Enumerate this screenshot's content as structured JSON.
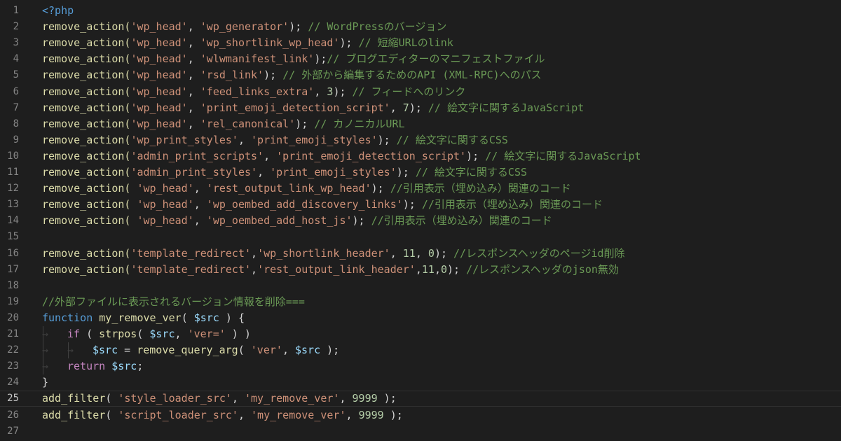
{
  "editor": {
    "language": "php",
    "active_line": 25,
    "lines": [
      {
        "n": "1",
        "tokens": [
          {
            "t": "<?php",
            "c": "tag"
          }
        ]
      },
      {
        "n": "2",
        "tokens": [
          {
            "t": "remove_action(",
            "c": "fn"
          },
          {
            "t": "'wp_head'",
            "c": "str"
          },
          {
            "t": ", ",
            "c": "pun"
          },
          {
            "t": "'wp_generator'",
            "c": "str"
          },
          {
            "t": "); ",
            "c": "pun"
          },
          {
            "t": "// WordPressのバージョン",
            "c": "cmt"
          }
        ]
      },
      {
        "n": "3",
        "tokens": [
          {
            "t": "remove_action(",
            "c": "fn"
          },
          {
            "t": "'wp_head'",
            "c": "str"
          },
          {
            "t": ", ",
            "c": "pun"
          },
          {
            "t": "'wp_shortlink_wp_head'",
            "c": "str"
          },
          {
            "t": "); ",
            "c": "pun"
          },
          {
            "t": "// 短縮URLのlink",
            "c": "cmt"
          }
        ]
      },
      {
        "n": "4",
        "tokens": [
          {
            "t": "remove_action(",
            "c": "fn"
          },
          {
            "t": "'wp_head'",
            "c": "str"
          },
          {
            "t": ", ",
            "c": "pun"
          },
          {
            "t": "'wlwmanifest_link'",
            "c": "str"
          },
          {
            "t": ");",
            "c": "pun"
          },
          {
            "t": "// ブログエディターのマニフェストファイル",
            "c": "cmt"
          }
        ]
      },
      {
        "n": "5",
        "tokens": [
          {
            "t": "remove_action(",
            "c": "fn"
          },
          {
            "t": "'wp_head'",
            "c": "str"
          },
          {
            "t": ", ",
            "c": "pun"
          },
          {
            "t": "'rsd_link'",
            "c": "str"
          },
          {
            "t": "); ",
            "c": "pun"
          },
          {
            "t": "// 外部から編集するためのAPI (XML-RPC)へのパス",
            "c": "cmt"
          }
        ]
      },
      {
        "n": "6",
        "tokens": [
          {
            "t": "remove_action(",
            "c": "fn"
          },
          {
            "t": "'wp_head'",
            "c": "str"
          },
          {
            "t": ", ",
            "c": "pun"
          },
          {
            "t": "'feed_links_extra'",
            "c": "str"
          },
          {
            "t": ", ",
            "c": "pun"
          },
          {
            "t": "3",
            "c": "num"
          },
          {
            "t": "); ",
            "c": "pun"
          },
          {
            "t": "// フィードへのリンク",
            "c": "cmt"
          }
        ]
      },
      {
        "n": "7",
        "tokens": [
          {
            "t": "remove_action(",
            "c": "fn"
          },
          {
            "t": "'wp_head'",
            "c": "str"
          },
          {
            "t": ", ",
            "c": "pun"
          },
          {
            "t": "'print_emoji_detection_script'",
            "c": "str"
          },
          {
            "t": ", ",
            "c": "pun"
          },
          {
            "t": "7",
            "c": "num"
          },
          {
            "t": "); ",
            "c": "pun"
          },
          {
            "t": "// 絵文字に関するJavaScript",
            "c": "cmt"
          }
        ]
      },
      {
        "n": "8",
        "tokens": [
          {
            "t": "remove_action(",
            "c": "fn"
          },
          {
            "t": "'wp_head'",
            "c": "str"
          },
          {
            "t": ", ",
            "c": "pun"
          },
          {
            "t": "'rel_canonical'",
            "c": "str"
          },
          {
            "t": "); ",
            "c": "pun"
          },
          {
            "t": "// カノニカルURL",
            "c": "cmt"
          }
        ]
      },
      {
        "n": "9",
        "tokens": [
          {
            "t": "remove_action(",
            "c": "fn"
          },
          {
            "t": "'wp_print_styles'",
            "c": "str"
          },
          {
            "t": ", ",
            "c": "pun"
          },
          {
            "t": "'print_emoji_styles'",
            "c": "str"
          },
          {
            "t": "); ",
            "c": "pun"
          },
          {
            "t": "// 絵文字に関するCSS",
            "c": "cmt"
          }
        ]
      },
      {
        "n": "10",
        "tokens": [
          {
            "t": "remove_action(",
            "c": "fn"
          },
          {
            "t": "'admin_print_scripts'",
            "c": "str"
          },
          {
            "t": ", ",
            "c": "pun"
          },
          {
            "t": "'print_emoji_detection_script'",
            "c": "str"
          },
          {
            "t": "); ",
            "c": "pun"
          },
          {
            "t": "// 絵文字に関するJavaScript",
            "c": "cmt"
          }
        ]
      },
      {
        "n": "11",
        "tokens": [
          {
            "t": "remove_action(",
            "c": "fn"
          },
          {
            "t": "'admin_print_styles'",
            "c": "str"
          },
          {
            "t": ", ",
            "c": "pun"
          },
          {
            "t": "'print_emoji_styles'",
            "c": "str"
          },
          {
            "t": "); ",
            "c": "pun"
          },
          {
            "t": "// 絵文字に関するCSS",
            "c": "cmt"
          }
        ]
      },
      {
        "n": "12",
        "tokens": [
          {
            "t": "remove_action( ",
            "c": "fn"
          },
          {
            "t": "'wp_head'",
            "c": "str"
          },
          {
            "t": ", ",
            "c": "pun"
          },
          {
            "t": "'rest_output_link_wp_head'",
            "c": "str"
          },
          {
            "t": "); ",
            "c": "pun"
          },
          {
            "t": "//引用表示（埋め込み）関連のコード",
            "c": "cmt"
          }
        ]
      },
      {
        "n": "13",
        "tokens": [
          {
            "t": "remove_action( ",
            "c": "fn"
          },
          {
            "t": "'wp_head'",
            "c": "str"
          },
          {
            "t": ", ",
            "c": "pun"
          },
          {
            "t": "'wp_oembed_add_discovery_links'",
            "c": "str"
          },
          {
            "t": "); ",
            "c": "pun"
          },
          {
            "t": "//引用表示（埋め込み）関連のコード",
            "c": "cmt"
          }
        ]
      },
      {
        "n": "14",
        "tokens": [
          {
            "t": "remove_action( ",
            "c": "fn"
          },
          {
            "t": "'wp_head'",
            "c": "str"
          },
          {
            "t": ", ",
            "c": "pun"
          },
          {
            "t": "'wp_oembed_add_host_js'",
            "c": "str"
          },
          {
            "t": "); ",
            "c": "pun"
          },
          {
            "t": "//引用表示（埋め込み）関連のコード",
            "c": "cmt"
          }
        ]
      },
      {
        "n": "15",
        "tokens": []
      },
      {
        "n": "16",
        "tokens": [
          {
            "t": "remove_action(",
            "c": "fn"
          },
          {
            "t": "'template_redirect'",
            "c": "str"
          },
          {
            "t": ",",
            "c": "pun"
          },
          {
            "t": "'wp_shortlink_header'",
            "c": "str"
          },
          {
            "t": ", ",
            "c": "pun"
          },
          {
            "t": "11",
            "c": "num"
          },
          {
            "t": ", ",
            "c": "pun"
          },
          {
            "t": "0",
            "c": "num"
          },
          {
            "t": "); ",
            "c": "pun"
          },
          {
            "t": "//レスポンスヘッダのページid削除",
            "c": "cmt"
          }
        ]
      },
      {
        "n": "17",
        "tokens": [
          {
            "t": "remove_action(",
            "c": "fn"
          },
          {
            "t": "'template_redirect'",
            "c": "str"
          },
          {
            "t": ",",
            "c": "pun"
          },
          {
            "t": "'rest_output_link_header'",
            "c": "str"
          },
          {
            "t": ",",
            "c": "pun"
          },
          {
            "t": "11",
            "c": "num"
          },
          {
            "t": ",",
            "c": "pun"
          },
          {
            "t": "0",
            "c": "num"
          },
          {
            "t": "); ",
            "c": "pun"
          },
          {
            "t": "//レスポンスヘッダのjson無効",
            "c": "cmt"
          }
        ]
      },
      {
        "n": "18",
        "tokens": []
      },
      {
        "n": "19",
        "tokens": [
          {
            "t": "//外部ファイルに表示されるバージョン情報を削除===",
            "c": "cmt"
          }
        ]
      },
      {
        "n": "20",
        "tokens": [
          {
            "t": "function",
            "c": "def"
          },
          {
            "t": " ",
            "c": "pun"
          },
          {
            "t": "my_remove_ver",
            "c": "fn"
          },
          {
            "t": "( ",
            "c": "pun"
          },
          {
            "t": "$src",
            "c": "var"
          },
          {
            "t": " ) {",
            "c": "pun"
          }
        ]
      },
      {
        "n": "21",
        "indent": 1,
        "tokens": [
          {
            "t": "if",
            "c": "kw"
          },
          {
            "t": " ( ",
            "c": "pun"
          },
          {
            "t": "strpos",
            "c": "fn"
          },
          {
            "t": "( ",
            "c": "pun"
          },
          {
            "t": "$src",
            "c": "var"
          },
          {
            "t": ", ",
            "c": "pun"
          },
          {
            "t": "'ver='",
            "c": "str"
          },
          {
            "t": " ) )",
            "c": "pun"
          }
        ]
      },
      {
        "n": "22",
        "indent": 2,
        "tokens": [
          {
            "t": "$src",
            "c": "var"
          },
          {
            "t": " = ",
            "c": "pun"
          },
          {
            "t": "remove_query_arg",
            "c": "fn"
          },
          {
            "t": "( ",
            "c": "pun"
          },
          {
            "t": "'ver'",
            "c": "str"
          },
          {
            "t": ", ",
            "c": "pun"
          },
          {
            "t": "$src",
            "c": "var"
          },
          {
            "t": " );",
            "c": "pun"
          }
        ]
      },
      {
        "n": "23",
        "indent": 1,
        "tokens": [
          {
            "t": "return",
            "c": "kw"
          },
          {
            "t": " ",
            "c": "pun"
          },
          {
            "t": "$src",
            "c": "var"
          },
          {
            "t": ";",
            "c": "pun"
          }
        ]
      },
      {
        "n": "24",
        "tokens": [
          {
            "t": "}",
            "c": "pun"
          }
        ]
      },
      {
        "n": "25",
        "tokens": [
          {
            "t": "add_filter",
            "c": "fn"
          },
          {
            "t": "( ",
            "c": "pun"
          },
          {
            "t": "'style_loader_src'",
            "c": "str"
          },
          {
            "t": ", ",
            "c": "pun"
          },
          {
            "t": "'my_remove_ver'",
            "c": "str"
          },
          {
            "t": ", ",
            "c": "pun"
          },
          {
            "t": "9999",
            "c": "num"
          },
          {
            "t": " );",
            "c": "pun"
          }
        ]
      },
      {
        "n": "26",
        "tokens": [
          {
            "t": "add_filter",
            "c": "fn"
          },
          {
            "t": "( ",
            "c": "pun"
          },
          {
            "t": "'script_loader_src'",
            "c": "str"
          },
          {
            "t": ", ",
            "c": "pun"
          },
          {
            "t": "'my_remove_ver'",
            "c": "str"
          },
          {
            "t": ", ",
            "c": "pun"
          },
          {
            "t": "9999",
            "c": "num"
          },
          {
            "t": " );",
            "c": "pun"
          }
        ]
      },
      {
        "n": "27",
        "tokens": []
      }
    ]
  }
}
